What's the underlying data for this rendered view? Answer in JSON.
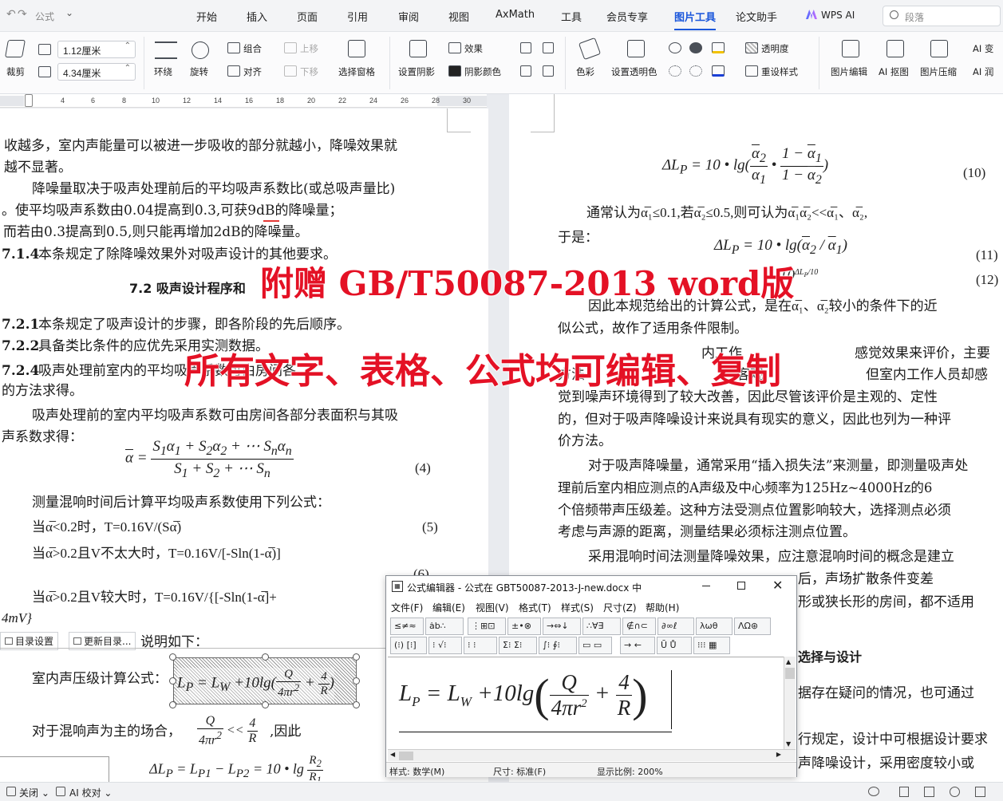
{
  "titlebar": {
    "undo": "↶",
    "redo": "↷",
    "formula": "公式",
    "dropdown": "⌄"
  },
  "tabs": [
    "开始",
    "插入",
    "页面",
    "引用",
    "审阅",
    "视图",
    "AxMath",
    "工具",
    "会员专享",
    "图片工具",
    "论文助手"
  ],
  "wps_ai": "WPS AI",
  "search_placeholder": "段落",
  "ribbon": {
    "crop": "裁剪",
    "width": "1.12厘米",
    "height": "4.34厘米",
    "wrap": "环绕",
    "rotate": "旋转",
    "group": "组合",
    "align": "对齐",
    "up": "上移",
    "down": "下移",
    "select_pane": "选择窗格",
    "set_shadow": "设置阴影",
    "effect": "效果",
    "shadow_color": "阴影颜色",
    "color": "色彩",
    "set_transparent": "设置透明色",
    "transparency": "透明度",
    "reset_style": "重设样式",
    "pic_edit": "图片编辑",
    "ai_matting": "AI 抠图",
    "pic_compress": "图片压缩",
    "ai_1": "AI 变",
    "ai_2": "AI 润"
  },
  "ruler": [
    "4",
    "6",
    "8",
    "10",
    "12",
    "14",
    "16",
    "18",
    "20",
    "22",
    "24",
    "26",
    "28",
    "30"
  ],
  "left_page": {
    "l1": "收越多，室内声能量可以被进一步吸收的部分就越小，降噪效果就",
    "l2": "越不显著。",
    "l3": "降噪量取决于吸声处理前后的平均吸声系数比(或总吸声量比)",
    "l4": "。使平均吸声系数由0.04提高到0.3,可获9dB的降噪量；",
    "l5": "而若由0.3提高到0.5,则只能再增加2dB的降噪量。",
    "s714_num": "7.1.4",
    "s714": "本条规定了除降噪效果外对吸声设计的其他要求。",
    "s72": "7.2  吸声设计程序和",
    "s721_num": "7.2.1",
    "s721": "本条规定了吸声设计的步骤，即各阶段的先后顺序。",
    "s722_num": "7.2.2",
    "s722": "具备类比条件的应优先采用实测数据。",
    "s724_num": "7.2.4",
    "s724": "吸声处理前室内的平均吸声系数可由房间各",
    "l6": "的方法求得。",
    "l7": "吸声处理前的室内平均吸声系数可由房间各部分表面积与其吸",
    "l8": "声系数求得：",
    "eq4": "(4)",
    "l9": "测量混响时间后计算平均吸声系数使用下列公式：",
    "l10": "当α̅<0.2时，T=0.16V/(Sα̅)",
    "eq5": "(5)",
    "l11": "当α̅>0.2且V不太大时，T=0.16V/[-Sln(1-α̅)]",
    "eq6": "(6)",
    "l12": "当α̅>0.2且V较大时，T=0.16V/{[-Sln(1-α̅]+",
    "l13": "4mV}",
    "l14": "说明如下：",
    "l15": "室内声压级计算公式：",
    "l16": "对于混响声为主的场合，",
    "l16b": ",因此"
  },
  "right_page": {
    "eq10": "(10)",
    "r1": "通常认为α̅₁≤0.1,若α̅₂≤0.5,则可认为α̅₁α̅₂<<α̅₁、α̅₂,",
    "r2": "于是：",
    "eq11": "(11)",
    "eq12": "(12)",
    "r3": "因此本规范给出的计算公式，是在α̅₁、α̅₂较小的条件下的近",
    "r4": "似公式，故作了适用条件限制。",
    "r5a": "内工作",
    "r5b": "感觉效果来评价，主要",
    "r6a": "方法",
    "r6b": "客观",
    "r6c": "但室内工作人员却感",
    "r7": "觉到噪声环境得到了较大改善，因此尽管该评价是主观的、定性",
    "r8": "的，但对于吸声降噪设计来说具有现实的意义，因此也列为一种评",
    "r9": "价方法。",
    "r10": "对于吸声降噪量，通常采用“插入损失法”来测量，即测量吸声处",
    "r11": "理前后室内相应测点的A声级及中心频率为125Hz~4000Hz的6",
    "r12": "个倍频带声压级差。这种方法受测点位置影响较大，选择测点必须",
    "r13": "考虑与声源的距离，测量结果必须标注测点位置。",
    "r14": "采用混响时间法测量降噪效果，应注意混响时间的概念是建立",
    "r15b": "后，声场扩散条件变差",
    "r16b": "形或狭长形的房间，都不适用",
    "r17": "选择与设计",
    "r18": "据存在疑问的情况，也可通过",
    "r19": "行规定，设计中可根据设计要求",
    "r20": "声降噪设计，采用密度较小或"
  },
  "overlay": {
    "line1": "附赠 GB/T50087-2013 word版",
    "line2": "所有文字、表格、公式均可编辑、复制"
  },
  "editor": {
    "title": "公式编辑器 - 公式在 GBT50087-2013-J-new.docx 中",
    "menus": [
      "文件(F)",
      "编辑(E)",
      "视图(V)",
      "格式(T)",
      "样式(S)",
      "尺寸(Z)",
      "帮助(H)"
    ],
    "row1": [
      "≤≠≈",
      "ȧb∴",
      "⋮⊞⊡",
      "±•⊗",
      "→⇔↓",
      "∴∀∃",
      "∉∩⊂",
      "∂∞ℓ",
      "λωθ",
      "ΛΩ⊛"
    ],
    "row2": [
      "(⁝) [⁝]",
      "⁝ √⁝",
      "⁝ ⁝",
      "Σ⁝ Σ⁝",
      "∫⁝ ∮⁝",
      "▭ ▭",
      "→ ←",
      "Ū Ů",
      "⁝⁝⁝ ▦"
    ],
    "status_style": "样式: 数学(M)",
    "status_size": "尺寸: 标准(F)",
    "status_zoom": "显示比例: 200%"
  },
  "float_toolbar": {
    "toc": "目录设置",
    "update": "更新目录..."
  },
  "statusbar": {
    "close": "关闭",
    "ai_check": "AI 校对"
  }
}
